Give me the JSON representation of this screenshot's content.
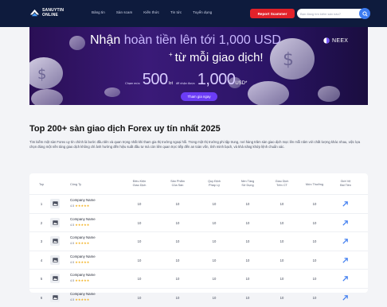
{
  "header": {
    "logo_line1": "SANUYTIN",
    "logo_line2": "ONLINE",
    "nav": [
      "Bảng tin",
      "Sàn scam",
      "Kiến thức",
      "Tin tức",
      "Tuyển dụng"
    ],
    "report_label": "Report Scammer",
    "search_placeholder": "Bạn đang tìm kiếm sàn nào?"
  },
  "banner": {
    "line1_a": "Nhận",
    "line1_b": "hoàn tiền lên tới 1,000 USD",
    "line2_plus": "+",
    "line2": "từ mỗi giao dịch!",
    "pre_lot": "Chạm mức",
    "lot_value": "500",
    "lot_unit": "lot",
    "mid_text": "để nhận được",
    "usd_value": "1,000",
    "usd_unit": "USD",
    "usd_sup": "*",
    "cta": "Tham gia ngay",
    "brand": "NEEX",
    "colors": {
      "accent": "#6b3cf6",
      "highlight": "#c9b8ff"
    }
  },
  "page": {
    "title": "Top 200+ sàn giao dịch Forex uy tín nhất 2025",
    "intro": "Tìm kiếm một sàn Forex uy tín chính là bước đầu tiên và quan trọng nhất khi tham gia thị trường ngoại hối. Trong một thị trường phi tập trung, nơi hàng trăm sàn giao dịch mọc lên mỗi năm với chất lượng khác nhau, việc lựa chọn đúng một nền tảng giao dịch không chỉ ảnh hưởng đến hiệu suất đầu tư mà còn liên quan trực tiếp đến an toàn vốn, tính minh bạch, và khả năng khớp lệnh chuẩn xác."
  },
  "table": {
    "headers": {
      "top": "Top",
      "company": "Công Ty",
      "c1_a": "Điều Kiện",
      "c1_b": "Giao Dịch",
      "c2_a": "Sản Phẩm",
      "c2_b": "Của Sàn",
      "c3_a": "Quy Định",
      "c3_b": "Pháp Lý",
      "c4_a": "Nền Tảng",
      "c4_b": "Sử Dụng",
      "c5_a": "Giao Dịch",
      "c5_b": "Trên CT",
      "c6": "Mức Thưởng",
      "c7_a": "Giới Vệ",
      "c7_b": "Bài Tiền"
    },
    "rows": [
      {
        "rank": "1",
        "name": "Company Name",
        "score": "4.5",
        "stars": "★★★★★",
        "vals": [
          "10",
          "10",
          "10",
          "10",
          "10",
          "10"
        ]
      },
      {
        "rank": "2",
        "name": "Company Name",
        "score": "4.5",
        "stars": "★★★★★",
        "vals": [
          "10",
          "10",
          "10",
          "10",
          "10",
          "10"
        ]
      },
      {
        "rank": "3",
        "name": "Company Name",
        "score": "4.5",
        "stars": "★★★★★",
        "vals": [
          "10",
          "10",
          "10",
          "10",
          "10",
          "10"
        ]
      },
      {
        "rank": "4",
        "name": "Company Name",
        "score": "4.5",
        "stars": "★★★★★",
        "vals": [
          "10",
          "10",
          "10",
          "10",
          "10",
          "10"
        ]
      },
      {
        "rank": "5",
        "name": "Company Name",
        "score": "4.5",
        "stars": "★★★★★",
        "vals": [
          "10",
          "10",
          "10",
          "10",
          "10",
          "10"
        ]
      },
      {
        "rank": "6",
        "name": "Company Name",
        "score": "4.5",
        "stars": "★★★★★",
        "vals": [
          "10",
          "10",
          "10",
          "10",
          "10",
          "10"
        ]
      }
    ]
  }
}
